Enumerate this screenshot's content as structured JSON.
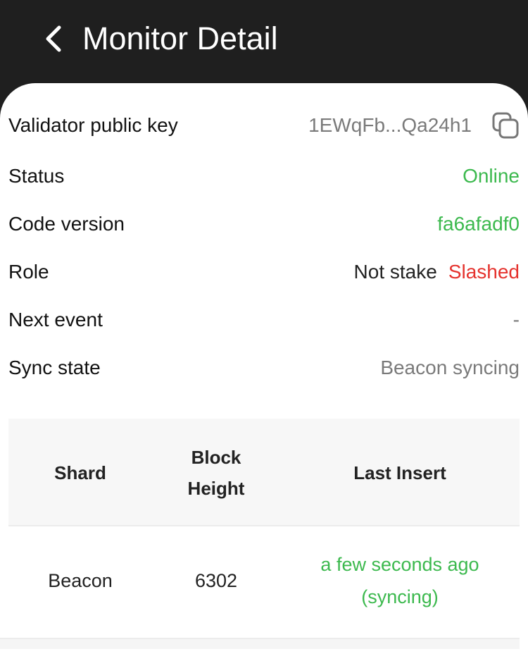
{
  "header": {
    "title": "Monitor Detail",
    "back_icon": "chevron-left-icon"
  },
  "details": {
    "public_key": {
      "label": "Validator public key",
      "value": "1EWqFb...Qa24h1",
      "icon": "copy-icon"
    },
    "status": {
      "label": "Status",
      "value": "Online"
    },
    "code_version": {
      "label": "Code version",
      "value": "fa6afadf0"
    },
    "role": {
      "label": "Role",
      "value": "Not stake",
      "badge": "Slashed"
    },
    "next_event": {
      "label": "Next event",
      "value": "-"
    },
    "sync_state": {
      "label": "Sync state",
      "value": "Beacon syncing"
    }
  },
  "table": {
    "headers": {
      "shard": "Shard",
      "block_height_line1": "Block",
      "block_height_line2": "Height",
      "last_insert": "Last Insert"
    },
    "rows": [
      {
        "shard": "Beacon",
        "block_height": "6302",
        "last_insert_line1": "a few seconds ago",
        "last_insert_line2": "(syncing)"
      }
    ]
  },
  "colors": {
    "header_bg": "#1f1f1f",
    "positive": "#3cb94e",
    "negative": "#e5322d",
    "muted": "#7a7a7a"
  }
}
